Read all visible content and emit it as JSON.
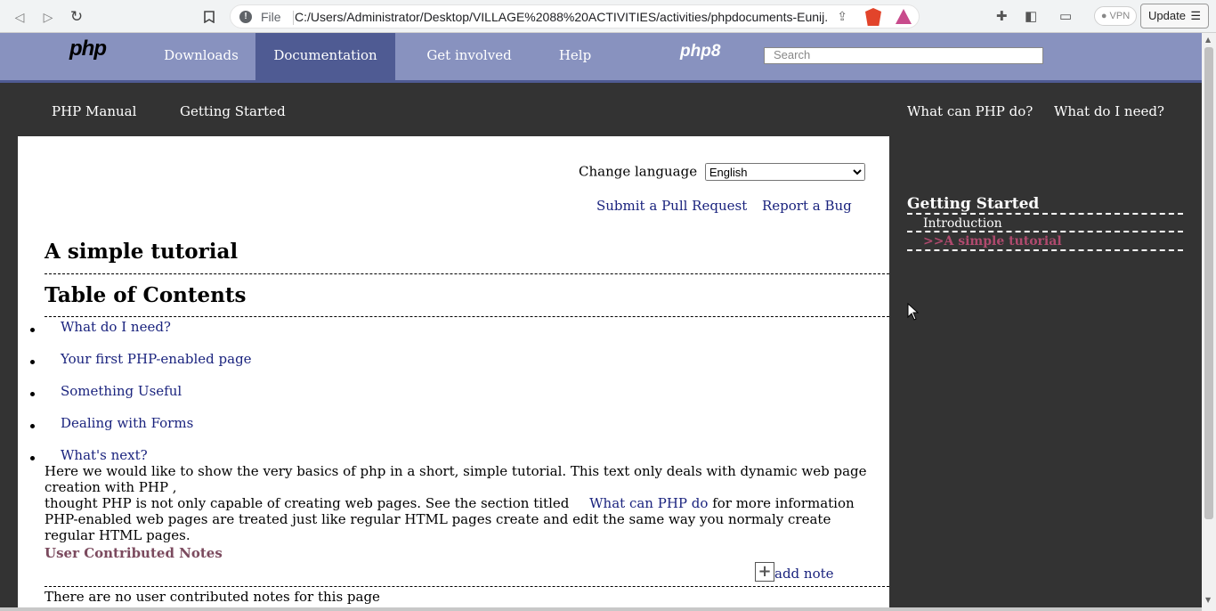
{
  "browser": {
    "file_label": "File",
    "url": "C:/Users/Administrator/Desktop/VILLAGE%2088%20ACTIVITIES/activities/phpdocuments-Eunij...",
    "vpn_label": "VPN",
    "update_label": "Update",
    "icons": [
      "back-icon",
      "forward-icon",
      "reload-icon",
      "bookmark-icon",
      "info-icon",
      "share-icon",
      "brave-shield-icon",
      "rewards-icon",
      "extensions-icon",
      "sidebar-icon",
      "wallet-icon",
      "menu-icon"
    ]
  },
  "header": {
    "logo": "php",
    "nav": [
      "Downloads",
      "Documentation",
      "Get involved",
      "Help"
    ],
    "active_nav": "Documentation",
    "php8_badge": "php8",
    "search_placeholder": "Search"
  },
  "subnav": {
    "left": [
      "PHP Manual",
      "Getting Started"
    ],
    "right": [
      "What can PHP do?",
      "What do I need?"
    ]
  },
  "content": {
    "change_language_label": "Change language",
    "language_selected": "English",
    "submit_pr": "Submit a Pull Request",
    "report_bug": "Report a Bug",
    "title": "A simple tutorial",
    "toc_heading": "Table of Contents",
    "toc": [
      "What do I need?",
      "Your first PHP-enabled page",
      "Something Useful",
      "Dealing with Forms",
      "What's next?"
    ],
    "para1": "Here we would like to show the very basics of php in a short, simple tutorial. This text only deals with dynamic web page creation with PHP ,",
    "para1b": "thought PHP is not only capable of creating web pages. See the section titled",
    "para1_link": "What can PHP do",
    "para1_end": "for more information",
    "para2": "PHP-enabled web pages are treated just like regular HTML pages create and edit the same way you normaly create regular HTML pages.",
    "notes_title": "User Contributed Notes",
    "add_note": "add note",
    "no_notes": "There are no user contributed notes for this page"
  },
  "sidebar": {
    "title": "Getting Started",
    "items": [
      "Introduction",
      ">>A simple tutorial"
    ],
    "current_index": 1
  },
  "colors": {
    "header_bg": "#8892bf",
    "active_nav": "#4f5b93",
    "page_bg": "#333333",
    "link": "#1a237e",
    "current_side": "#b04a6e"
  }
}
